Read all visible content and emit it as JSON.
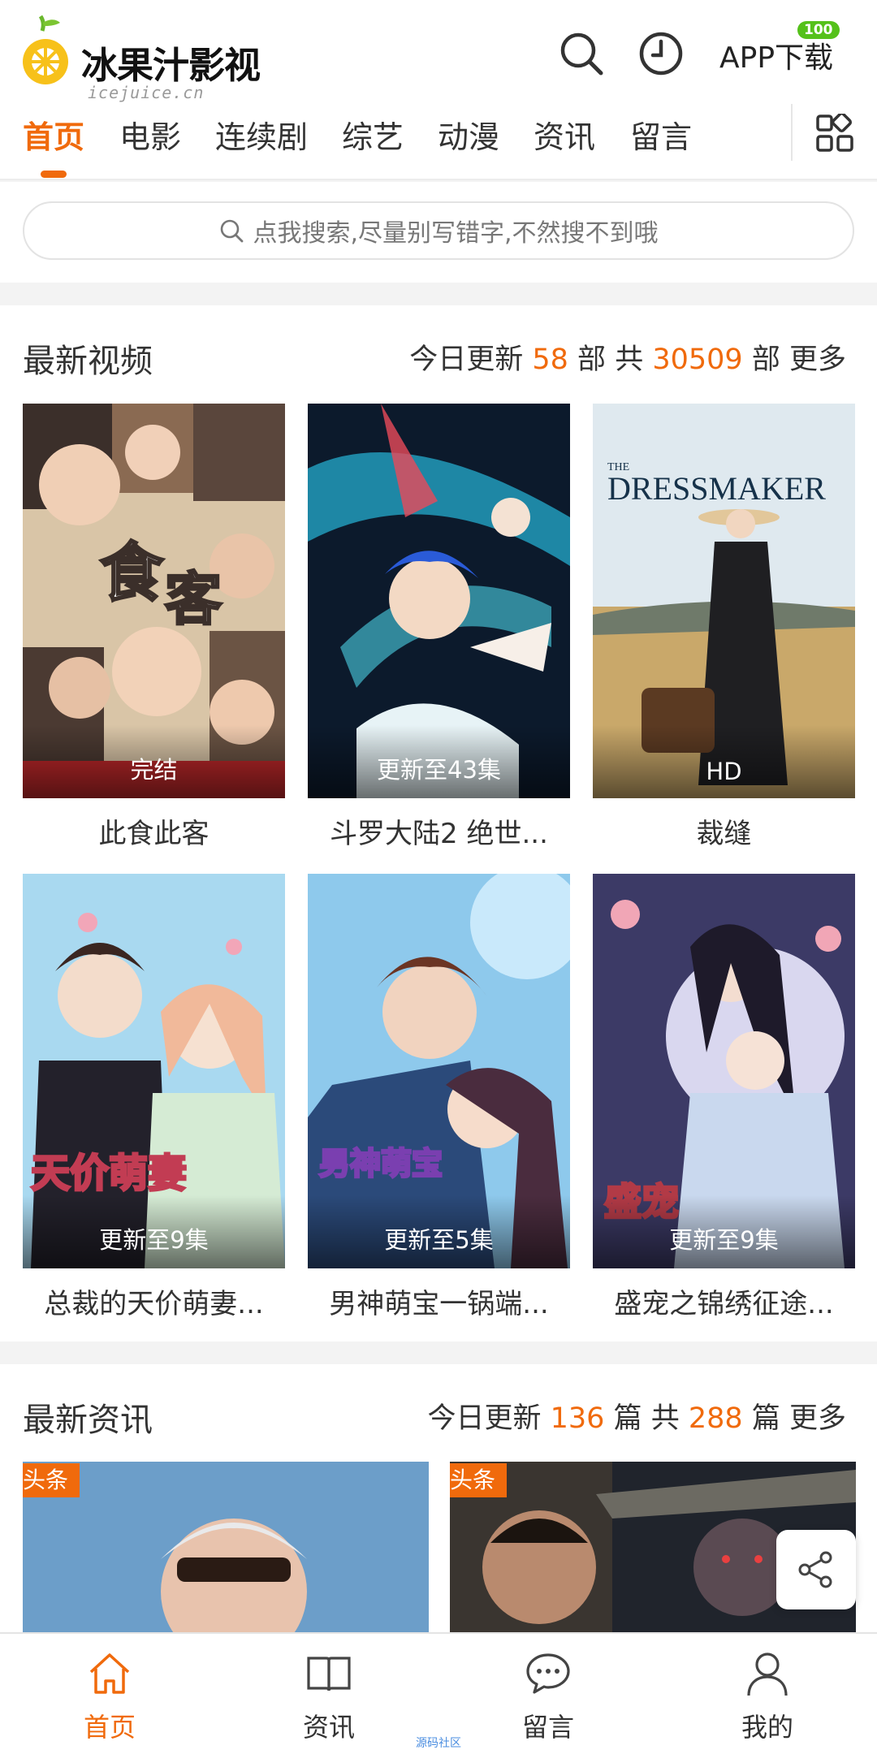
{
  "header": {
    "logo_name": "冰果汁影视",
    "logo_domain": "icejuice.cn",
    "app_download": "APP下载",
    "app_badge": "100"
  },
  "nav": {
    "items": [
      "首页",
      "电影",
      "连续剧",
      "综艺",
      "动漫",
      "资讯",
      "留言"
    ],
    "active": "首页"
  },
  "search": {
    "placeholder": "点我搜索,尽量别写错字,不然搜不到哦"
  },
  "latest_videos": {
    "title": "最新视频",
    "today_label": "今日更新",
    "today_count": "58",
    "unit": "部",
    "total_label": "共",
    "total_count": "30509",
    "more": "更多",
    "items": [
      {
        "title": "此食此客",
        "status": "完结"
      },
      {
        "title": "斗罗大陆2 绝世...",
        "status": "更新至43集"
      },
      {
        "title": "裁缝",
        "status": "HD"
      },
      {
        "title": "总裁的天价萌妻...",
        "status": "更新至9集"
      },
      {
        "title": "男神萌宝一锅端...",
        "status": "更新至5集"
      },
      {
        "title": "盛宠之锦绣征途...",
        "status": "更新至9集"
      }
    ]
  },
  "latest_news": {
    "title": "最新资讯",
    "today_label": "今日更新",
    "today_count": "136",
    "unit": "篇",
    "total_label": "共",
    "total_count": "288",
    "more": "更多",
    "items": [
      {
        "tag": "头条"
      },
      {
        "tag": "头条"
      }
    ]
  },
  "tabbar": {
    "items": [
      {
        "label": "首页",
        "icon": "home-icon"
      },
      {
        "label": "资讯",
        "icon": "book-icon"
      },
      {
        "label": "留言",
        "icon": "chat-icon"
      },
      {
        "label": "我的",
        "icon": "user-icon"
      }
    ],
    "active": "首页"
  },
  "footer_note": "源码社区",
  "colors": {
    "accent": "#f06a0c",
    "badge": "#55c11b"
  }
}
